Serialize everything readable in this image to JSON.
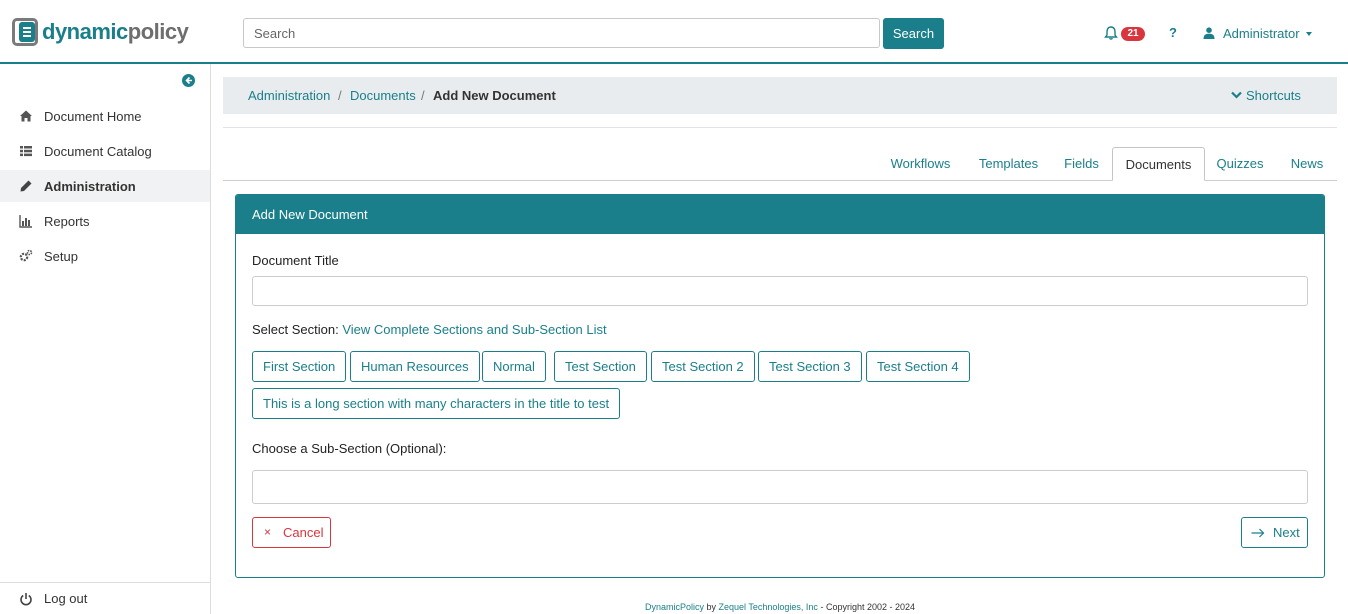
{
  "brand": {
    "name_part1": "dynamic",
    "name_part2": "policy"
  },
  "header": {
    "search_placeholder": "Search",
    "search_button": "Search",
    "notifications_count": "21",
    "help_label": "?",
    "user_name": "Administrator"
  },
  "sidebar": {
    "items": [
      {
        "label": "Document Home",
        "icon": "home-icon"
      },
      {
        "label": "Document Catalog",
        "icon": "list-icon"
      },
      {
        "label": "Administration",
        "icon": "pencil-icon",
        "active": true
      },
      {
        "label": "Reports",
        "icon": "bar-chart-icon"
      },
      {
        "label": "Setup",
        "icon": "cogs-icon"
      }
    ],
    "logout_label": "Log out"
  },
  "breadcrumb": {
    "items": [
      "Administration",
      "Documents",
      "Add New Document"
    ],
    "separator": "/",
    "shortcuts_label": "Shortcuts"
  },
  "tabs": [
    "Workflows",
    "Templates",
    "Fields",
    "Documents",
    "Quizzes",
    "News"
  ],
  "active_tab": "Documents",
  "card": {
    "title": "Add New Document",
    "document_title_label": "Document Title",
    "document_title_value": "",
    "select_section_label": "Select Section:",
    "view_sections_link": "View Complete Sections and Sub-Section List",
    "sections": [
      "First Section",
      "Human Resources",
      "Normal",
      "Test Section",
      "Test Section 2",
      "Test Section 3",
      "Test Section 4",
      "This is a long section with many characters in the title to test"
    ],
    "subsection_label": "Choose a Sub-Section (Optional):",
    "subsection_value": "",
    "cancel_label": "Cancel",
    "cancel_glyph": "×",
    "next_label": "Next"
  },
  "footer": {
    "product": "DynamicPolicy",
    "by": "by",
    "company": "Zequel Technologies, Inc",
    "copyright": "- Copyright 2002 - 2024"
  },
  "colors": {
    "accent": "#1a7f8a",
    "danger": "#d9353f",
    "breadcrumb_bg": "#e9ecef"
  }
}
